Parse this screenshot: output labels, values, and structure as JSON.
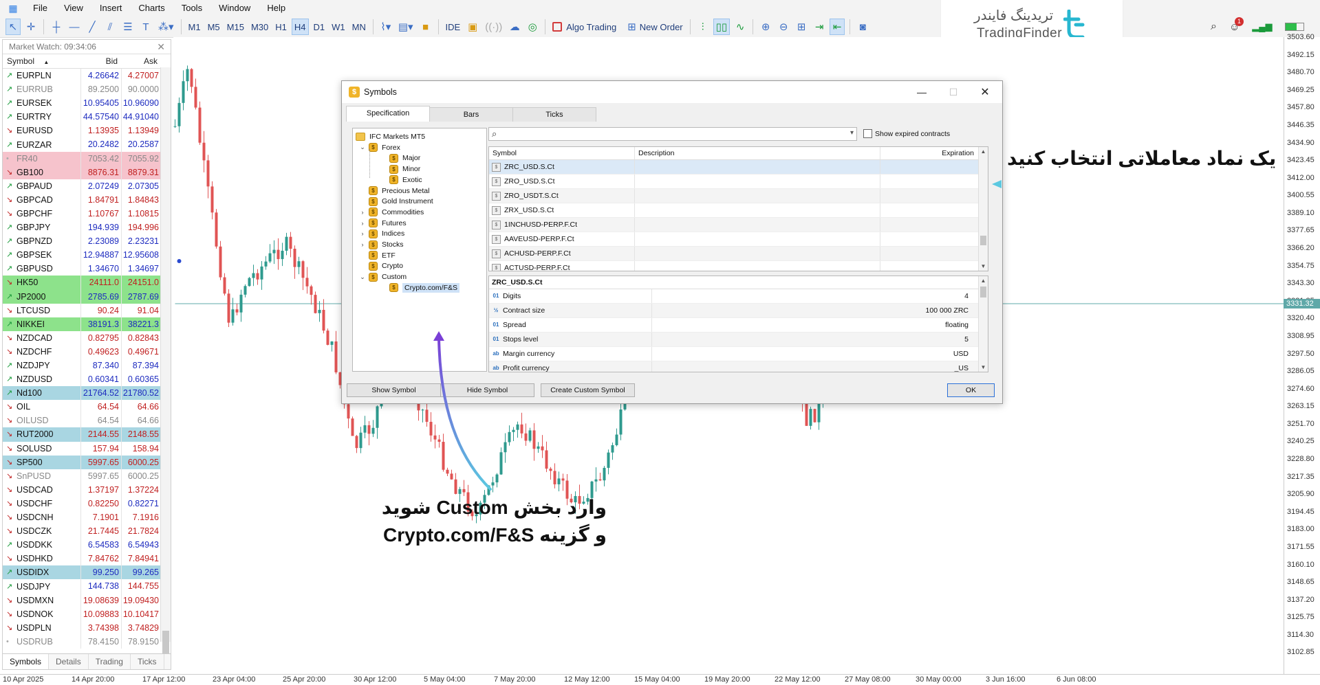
{
  "menu": {
    "items": [
      "File",
      "View",
      "Insert",
      "Charts",
      "Tools",
      "Window",
      "Help"
    ]
  },
  "toolbar": {
    "timeframes": [
      "M1",
      "M5",
      "M15",
      "M30",
      "H1",
      "H4",
      "D1",
      "W1",
      "MN"
    ],
    "active_timeframe": "H4",
    "ide": "IDE",
    "algo_trading": "Algo Trading",
    "new_order": "New Order"
  },
  "logo": {
    "fa": "تریدینگ فایندر",
    "en": "TradingFinder"
  },
  "notifications": {
    "count": "1"
  },
  "market_watch": {
    "title": "Market Watch: 09:34:06",
    "col_symbol": "Symbol",
    "col_bid": "Bid",
    "col_ask": "Ask",
    "rows": [
      {
        "s": "EURPLN",
        "b": "4.26642",
        "a": "4.27007",
        "d": "up",
        "bg": "",
        "sc": "#1d2bbf",
        "sa": "#c02020"
      },
      {
        "s": "EURRUB",
        "b": "89.2500",
        "a": "90.0000",
        "d": "up",
        "bg": "",
        "sc": "#444",
        "sa": "#444",
        "dim": true
      },
      {
        "s": "EURSEK",
        "b": "10.95405",
        "a": "10.96090",
        "d": "up",
        "bg": "",
        "sc": "#1d2bbf",
        "sa": "#1d2bbf"
      },
      {
        "s": "EURTRY",
        "b": "44.57540",
        "a": "44.91040",
        "d": "up",
        "bg": "",
        "sc": "#1d2bbf",
        "sa": "#1d2bbf"
      },
      {
        "s": "EURUSD",
        "b": "1.13935",
        "a": "1.13949",
        "d": "dn",
        "bg": "",
        "sc": "#c02020",
        "sa": "#c02020"
      },
      {
        "s": "EURZAR",
        "b": "20.2482",
        "a": "20.2587",
        "d": "up",
        "bg": "",
        "sc": "#1d2bbf",
        "sa": "#1d2bbf"
      },
      {
        "s": "FR40",
        "b": "7053.42",
        "a": "7055.92",
        "d": "dot",
        "bg": "#f6c3cc",
        "sc": "#333",
        "sa": "#333",
        "dim": true
      },
      {
        "s": "GB100",
        "b": "8876.31",
        "a": "8879.31",
        "d": "dn",
        "bg": "#f6c3cc",
        "sc": "#c02020",
        "sa": "#c02020"
      },
      {
        "s": "GBPAUD",
        "b": "2.07249",
        "a": "2.07305",
        "d": "up",
        "bg": "",
        "sc": "#1d2bbf",
        "sa": "#1d2bbf"
      },
      {
        "s": "GBPCAD",
        "b": "1.84791",
        "a": "1.84843",
        "d": "dn",
        "bg": "",
        "sc": "#c02020",
        "sa": "#c02020"
      },
      {
        "s": "GBPCHF",
        "b": "1.10767",
        "a": "1.10815",
        "d": "dn",
        "bg": "",
        "sc": "#c02020",
        "sa": "#c02020"
      },
      {
        "s": "GBPJPY",
        "b": "194.939",
        "a": "194.996",
        "d": "up",
        "bg": "",
        "sc": "#1d2bbf",
        "sa": "#c02020"
      },
      {
        "s": "GBPNZD",
        "b": "2.23089",
        "a": "2.23231",
        "d": "up",
        "bg": "",
        "sc": "#1d2bbf",
        "sa": "#1d2bbf"
      },
      {
        "s": "GBPSEK",
        "b": "12.94887",
        "a": "12.95608",
        "d": "up",
        "bg": "",
        "sc": "#1d2bbf",
        "sa": "#1d2bbf"
      },
      {
        "s": "GBPUSD",
        "b": "1.34670",
        "a": "1.34697",
        "d": "up",
        "bg": "",
        "sc": "#1d2bbf",
        "sa": "#1d2bbf"
      },
      {
        "s": "HK50",
        "b": "24111.0",
        "a": "24151.0",
        "d": "dn",
        "bg": "#8de28b",
        "sc": "#c02020",
        "sa": "#c02020"
      },
      {
        "s": "JP2000",
        "b": "2785.69",
        "a": "2787.69",
        "d": "up",
        "bg": "#8de28b",
        "sc": "#1d2bbf",
        "sa": "#1d2bbf"
      },
      {
        "s": "LTCUSD",
        "b": "90.24",
        "a": "91.04",
        "d": "dn",
        "bg": "",
        "sc": "#c02020",
        "sa": "#c02020"
      },
      {
        "s": "NIKKEI",
        "b": "38191.3",
        "a": "38221.3",
        "d": "up",
        "bg": "#8de28b",
        "sc": "#1d2bbf",
        "sa": "#1d2bbf"
      },
      {
        "s": "NZDCAD",
        "b": "0.82795",
        "a": "0.82843",
        "d": "dn",
        "bg": "",
        "sc": "#c02020",
        "sa": "#c02020"
      },
      {
        "s": "NZDCHF",
        "b": "0.49623",
        "a": "0.49671",
        "d": "dn",
        "bg": "",
        "sc": "#c02020",
        "sa": "#c02020"
      },
      {
        "s": "NZDJPY",
        "b": "87.340",
        "a": "87.394",
        "d": "up",
        "bg": "",
        "sc": "#1d2bbf",
        "sa": "#1d2bbf"
      },
      {
        "s": "NZDUSD",
        "b": "0.60341",
        "a": "0.60365",
        "d": "up",
        "bg": "",
        "sc": "#1d2bbf",
        "sa": "#1d2bbf"
      },
      {
        "s": "Nd100",
        "b": "21764.52",
        "a": "21780.52",
        "d": "up",
        "bg": "#a9d6e2",
        "sc": "#1d2bbf",
        "sa": "#1d2bbf"
      },
      {
        "s": "OIL",
        "b": "64.54",
        "a": "64.66",
        "d": "dn",
        "bg": "",
        "sc": "#c02020",
        "sa": "#c02020"
      },
      {
        "s": "OILUSD",
        "b": "64.54",
        "a": "64.66",
        "d": "dn",
        "bg": "",
        "sc": "#c02020",
        "sa": "#c02020",
        "dim": true
      },
      {
        "s": "RUT2000",
        "b": "2144.55",
        "a": "2148.55",
        "d": "dn",
        "bg": "#a9d6e2",
        "sc": "#c02020",
        "sa": "#c02020"
      },
      {
        "s": "SOLUSD",
        "b": "157.94",
        "a": "158.94",
        "d": "dn",
        "bg": "",
        "sc": "#c02020",
        "sa": "#c02020"
      },
      {
        "s": "SP500",
        "b": "5997.65",
        "a": "6000.25",
        "d": "dn",
        "bg": "#a9d6e2",
        "sc": "#c02020",
        "sa": "#c02020"
      },
      {
        "s": "SnPUSD",
        "b": "5997.65",
        "a": "6000.25",
        "d": "dn",
        "bg": "",
        "sc": "#c02020",
        "sa": "#c02020",
        "dim": true
      },
      {
        "s": "USDCAD",
        "b": "1.37197",
        "a": "1.37224",
        "d": "dn",
        "bg": "",
        "sc": "#c02020",
        "sa": "#c02020"
      },
      {
        "s": "USDCHF",
        "b": "0.82250",
        "a": "0.82271",
        "d": "dn",
        "bg": "",
        "sc": "#c02020",
        "sa": "#1d2bbf"
      },
      {
        "s": "USDCNH",
        "b": "7.1901",
        "a": "7.1916",
        "d": "dn",
        "bg": "",
        "sc": "#c02020",
        "sa": "#c02020"
      },
      {
        "s": "USDCZK",
        "b": "21.7445",
        "a": "21.7824",
        "d": "dn",
        "bg": "",
        "sc": "#c02020",
        "sa": "#c02020"
      },
      {
        "s": "USDDKK",
        "b": "6.54583",
        "a": "6.54943",
        "d": "up",
        "bg": "",
        "sc": "#1d2bbf",
        "sa": "#1d2bbf"
      },
      {
        "s": "USDHKD",
        "b": "7.84762",
        "a": "7.84941",
        "d": "dn",
        "bg": "",
        "sc": "#c02020",
        "sa": "#c02020"
      },
      {
        "s": "USDIDX",
        "b": "99.250",
        "a": "99.265",
        "d": "up",
        "bg": "#a9d6e2",
        "sc": "#1d2bbf",
        "sa": "#1d2bbf"
      },
      {
        "s": "USDJPY",
        "b": "144.738",
        "a": "144.755",
        "d": "up",
        "bg": "",
        "sc": "#1d2bbf",
        "sa": "#c02020"
      },
      {
        "s": "USDMXN",
        "b": "19.08639",
        "a": "19.09430",
        "d": "dn",
        "bg": "",
        "sc": "#c02020",
        "sa": "#c02020"
      },
      {
        "s": "USDNOK",
        "b": "10.09883",
        "a": "10.10417",
        "d": "dn",
        "bg": "",
        "sc": "#c02020",
        "sa": "#c02020"
      },
      {
        "s": "USDPLN",
        "b": "3.74398",
        "a": "3.74829",
        "d": "dn",
        "bg": "",
        "sc": "#c02020",
        "sa": "#c02020"
      },
      {
        "s": "USDRUB",
        "b": "78.4150",
        "a": "78.9150",
        "d": "dot",
        "bg": "",
        "sc": "#333",
        "sa": "#333",
        "dim": true
      }
    ],
    "tabs": [
      "Symbols",
      "Details",
      "Trading",
      "Ticks"
    ]
  },
  "dialog": {
    "title": "Symbols",
    "tabs": [
      "Specification",
      "Bars",
      "Ticks"
    ],
    "tree": [
      {
        "label": "IFC Markets MT5",
        "level": 0,
        "kind": "folder",
        "exp": ""
      },
      {
        "label": "Forex",
        "level": 1,
        "kind": "coin",
        "exp": "v"
      },
      {
        "label": "Major",
        "level": 2,
        "kind": "coin",
        "exp": ""
      },
      {
        "label": "Minor",
        "level": 2,
        "kind": "coin",
        "exp": ""
      },
      {
        "label": "Exotic",
        "level": 2,
        "kind": "coin",
        "exp": ""
      },
      {
        "label": "Precious Metal",
        "level": 1,
        "kind": "coin",
        "exp": ""
      },
      {
        "label": "Gold Instrument",
        "level": 1,
        "kind": "coin",
        "exp": ""
      },
      {
        "label": "Commodities",
        "level": 1,
        "kind": "coin",
        "exp": ">"
      },
      {
        "label": "Futures",
        "level": 1,
        "kind": "coin",
        "exp": ">"
      },
      {
        "label": "Indices",
        "level": 1,
        "kind": "coin",
        "exp": ">"
      },
      {
        "label": "Stocks",
        "level": 1,
        "kind": "coin",
        "exp": ">"
      },
      {
        "label": "ETF",
        "level": 1,
        "kind": "coin",
        "exp": ""
      },
      {
        "label": "Crypto",
        "level": 1,
        "kind": "coin",
        "exp": ""
      },
      {
        "label": "Custom",
        "level": 1,
        "kind": "coin",
        "exp": "v"
      },
      {
        "label": "Crypto.com/F&S",
        "level": 2,
        "kind": "coin",
        "exp": "",
        "sel": true
      }
    ],
    "search_value": "",
    "show_expired": "Show expired contracts",
    "table_cols": [
      "Symbol",
      "Description",
      "Expiration"
    ],
    "symbols": [
      "ZRC_USD.S.Ct",
      "ZRO_USD.S.Ct",
      "ZRO_USDT.S.Ct",
      "ZRX_USD.S.Ct",
      "1INCHUSD-PERP.F.Ct",
      "AAVEUSD-PERP.F.Ct",
      "ACHUSD-PERP.F.Ct",
      "ACTUSD-PERP.F.Ct"
    ],
    "spec_title": "ZRC_USD.S.Ct",
    "spec": [
      {
        "icon": "01",
        "k": "Digits",
        "v": "4"
      },
      {
        "icon": "½",
        "k": "Contract size",
        "v": "100 000 ZRC"
      },
      {
        "icon": "01",
        "k": "Spread",
        "v": "floating"
      },
      {
        "icon": "01",
        "k": "Stops level",
        "v": "5"
      },
      {
        "icon": "ab",
        "k": "Margin currency",
        "v": "USD"
      },
      {
        "icon": "ab",
        "k": "Profit currency",
        "v": "_US"
      }
    ],
    "buttons": {
      "show": "Show Symbol",
      "hide": "Hide Symbol",
      "custom": "Create Custom Symbol",
      "ok": "OK"
    }
  },
  "annotations": {
    "right": "یک نماد معاملاتی انتخاب کنید",
    "left_line1": "وارد بخش Custom شوید",
    "left_line2": "و گزینه Crypto.com/F&S"
  },
  "price_axis": [
    "3503.60",
    "3492.15",
    "3480.70",
    "3469.25",
    "3457.80",
    "3446.35",
    "3434.90",
    "3423.45",
    "3412.00",
    "3400.55",
    "3389.10",
    "3377.65",
    "3366.20",
    "3354.75",
    "3343.30",
    "3331.85",
    "3320.40",
    "3308.95",
    "3297.50",
    "3286.05",
    "3274.60",
    "3263.15",
    "3251.70",
    "3240.25",
    "3228.80",
    "3217.35",
    "3205.90",
    "3194.45",
    "3183.00",
    "3171.55",
    "3160.10",
    "3148.65",
    "3137.20",
    "3125.75",
    "3114.30",
    "3102.85"
  ],
  "current_price": "3331.32",
  "time_axis": [
    "10 Apr 2025",
    "14 Apr 20:00",
    "17 Apr 12:00",
    "23 Apr 04:00",
    "25 Apr 20:00",
    "30 Apr 12:00",
    "5 May 04:00",
    "7 May 20:00",
    "12 May 12:00",
    "15 May 04:00",
    "19 May 20:00",
    "22 May 12:00",
    "27 May 08:00",
    "30 May 00:00",
    "3 Jun 16:00",
    "6 Jun 08:00"
  ],
  "colors": {
    "bull": "#2e9a8e",
    "bear": "#e05454",
    "price_line": "#5fa8a8"
  }
}
